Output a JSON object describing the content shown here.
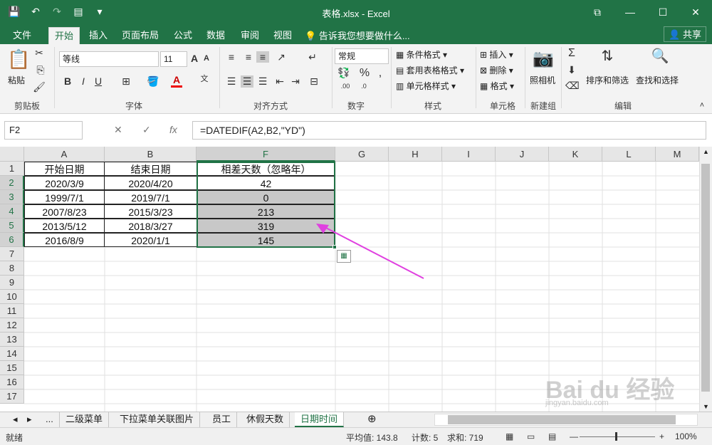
{
  "window": {
    "title": "表格.xlsx - Excel"
  },
  "qat": {
    "save_icon": "save-icon",
    "undo_icon": "undo-icon",
    "redo_icon": "redo-icon",
    "form_icon": "form-icon",
    "customize_icon": "customize-icon"
  },
  "tabs": [
    "文件",
    "开始",
    "插入",
    "页面布局",
    "公式",
    "数据",
    "审阅",
    "视图"
  ],
  "tell_me": "告诉我您想要做什么...",
  "share": "共享",
  "ribbon": {
    "clipboard": {
      "paste": "粘贴",
      "label": "剪贴板"
    },
    "font": {
      "name": "等线",
      "size": "11",
      "label": "字体",
      "bold": "B",
      "italic": "I",
      "underline": "U",
      "grow": "A",
      "shrink": "A"
    },
    "align": {
      "label": "对齐方式"
    },
    "number": {
      "format": "常规",
      "label": "数字",
      "percent": "%",
      "comma": ",",
      "inc": ".0\n.00",
      "dec": ".00\n.0"
    },
    "styles": {
      "conditional": "条件格式",
      "table": "套用表格格式",
      "cell": "单元格样式",
      "label": "样式"
    },
    "cells": {
      "insert": "插入",
      "delete": "删除",
      "format": "格式",
      "label": "单元格"
    },
    "new_group": {
      "camera": "照相机",
      "label": "新建组"
    },
    "editing": {
      "sort": "排序和筛选",
      "find": "查找和选择",
      "label": "编辑"
    }
  },
  "formula_bar": {
    "name_box": "F2",
    "formula": "=DATEDIF(A2,B2,\"YD\")"
  },
  "columns": [
    "A",
    "B",
    "F",
    "G",
    "H",
    "I",
    "J",
    "K",
    "L",
    "M"
  ],
  "rows": [
    "1",
    "2",
    "3",
    "4",
    "5",
    "6",
    "7",
    "8",
    "9",
    "10",
    "11",
    "12",
    "13",
    "14",
    "15",
    "16",
    "17"
  ],
  "table": {
    "headers": [
      "开始日期",
      "结束日期",
      "相差天数（忽略年）"
    ],
    "rows": [
      [
        "2020/3/9",
        "2020/4/20",
        "42"
      ],
      [
        "1999/7/1",
        "2019/7/1",
        "0"
      ],
      [
        "2007/8/23",
        "2015/3/23",
        "213"
      ],
      [
        "2013/5/12",
        "2018/3/27",
        "319"
      ],
      [
        "2016/8/9",
        "2020/1/1",
        "145"
      ]
    ]
  },
  "sheet_tabs": [
    "...",
    "二级菜单",
    "下拉菜单关联图片",
    "员工",
    "休假天数",
    "日期时间"
  ],
  "active_sheet": "日期时间",
  "status": {
    "ready": "就绪",
    "average": "平均值: 143.8",
    "count": "计数: 5",
    "sum": "求和: 719",
    "zoom": "100%"
  },
  "colors": {
    "accent": "#217346",
    "arrow": "#e040e0",
    "shade": "#c8c8c8"
  },
  "watermark": {
    "main": "Bai du 经验",
    "sub": "jingyan.baidu.com"
  }
}
